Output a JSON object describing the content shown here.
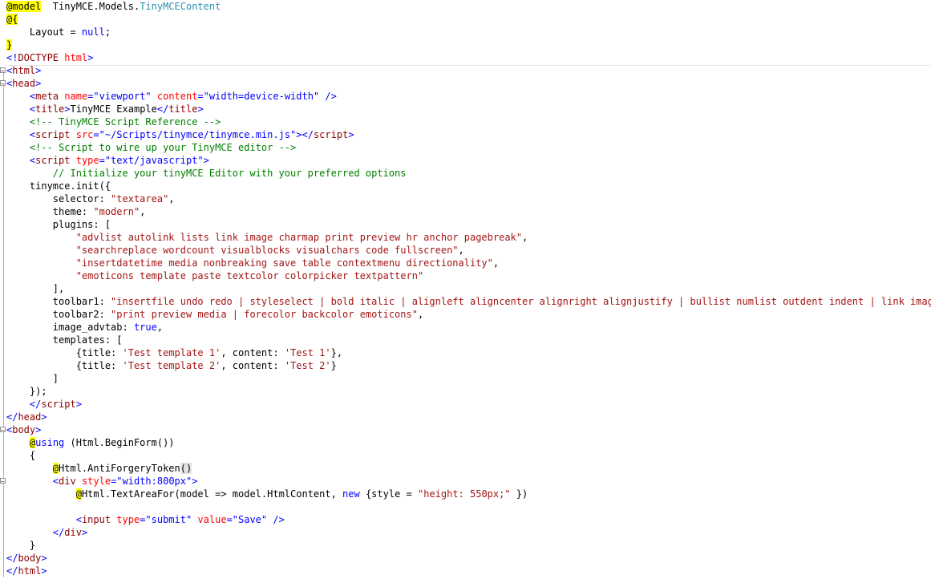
{
  "lines": [
    [
      [
        "hl",
        "@model"
      ],
      [
        "",
        "  TinyMCE.Models."
      ],
      [
        "t",
        "TinyMCEContent"
      ]
    ],
    [
      [
        "hl",
        "@{"
      ]
    ],
    [
      [
        "",
        "    Layout = "
      ],
      [
        "k",
        "null"
      ],
      [
        "",
        ";"
      ]
    ],
    [
      [
        "hl",
        "}"
      ]
    ],
    [
      [
        "k",
        "<!"
      ],
      [
        "m",
        "DOCTYPE"
      ],
      [
        "r",
        " html"
      ],
      [
        "k",
        ">"
      ]
    ],
    [
      [
        "k",
        "<"
      ],
      [
        "m",
        "html"
      ],
      [
        "k",
        ">"
      ]
    ],
    [
      [
        "k",
        "<"
      ],
      [
        "m",
        "head"
      ],
      [
        "k",
        ">"
      ]
    ],
    [
      [
        "",
        "    "
      ],
      [
        "k",
        "<"
      ],
      [
        "m",
        "meta"
      ],
      [
        "r",
        " name"
      ],
      [
        "k",
        "=\"viewport\" "
      ],
      [
        "r",
        "content"
      ],
      [
        "k",
        "=\"width=device-width\" />"
      ]
    ],
    [
      [
        "",
        "    "
      ],
      [
        "k",
        "<"
      ],
      [
        "m",
        "title"
      ],
      [
        "k",
        ">"
      ],
      [
        "",
        "TinyMCE Example"
      ],
      [
        "k",
        "</"
      ],
      [
        "m",
        "title"
      ],
      [
        "k",
        ">"
      ]
    ],
    [
      [
        "",
        "    "
      ],
      [
        "c",
        "<!-- TinyMCE Script Reference -->"
      ]
    ],
    [
      [
        "",
        "    "
      ],
      [
        "k",
        "<"
      ],
      [
        "m",
        "script"
      ],
      [
        "r",
        " src"
      ],
      [
        "k",
        "=\"~/Scripts/tinymce/tinymce.min.js\">"
      ],
      [
        "k",
        "</"
      ],
      [
        "m",
        "script"
      ],
      [
        "k",
        ">"
      ]
    ],
    [
      [
        "",
        "    "
      ],
      [
        "c",
        "<!-- Script to wire up your TinyMCE editor -->"
      ]
    ],
    [
      [
        "",
        "    "
      ],
      [
        "k",
        "<"
      ],
      [
        "m",
        "script"
      ],
      [
        "r",
        " type"
      ],
      [
        "k",
        "=\"text/javascript\">"
      ]
    ],
    [
      [
        "",
        "        "
      ],
      [
        "c",
        "// Initialize your tinyMCE Editor with your preferred options"
      ]
    ],
    [
      [
        "",
        "    tinymce.init({"
      ]
    ],
    [
      [
        "",
        "        selector: "
      ],
      [
        "cs",
        "\"textarea\""
      ],
      [
        "",
        ","
      ]
    ],
    [
      [
        "",
        "        theme: "
      ],
      [
        "cs",
        "\"modern\""
      ],
      [
        "",
        ","
      ]
    ],
    [
      [
        "",
        "        plugins: ["
      ]
    ],
    [
      [
        "",
        "            "
      ],
      [
        "cs",
        "\"advlist autolink lists link image charmap print preview hr anchor pagebreak\""
      ],
      [
        "",
        ","
      ]
    ],
    [
      [
        "",
        "            "
      ],
      [
        "cs",
        "\"searchreplace wordcount visualblocks visualchars code fullscreen\""
      ],
      [
        "",
        ","
      ]
    ],
    [
      [
        "",
        "            "
      ],
      [
        "cs",
        "\"insertdatetime media nonbreaking save table contextmenu directionality\""
      ],
      [
        "",
        ","
      ]
    ],
    [
      [
        "",
        "            "
      ],
      [
        "cs",
        "\"emoticons template paste textcolor colorpicker textpattern\""
      ]
    ],
    [
      [
        "",
        "        ],"
      ]
    ],
    [
      [
        "",
        "        toolbar1: "
      ],
      [
        "cs",
        "\"insertfile undo redo | styleselect | bold italic | alignleft aligncenter alignright alignjustify | bullist numlist outdent indent | link image\""
      ],
      [
        "",
        ","
      ]
    ],
    [
      [
        "",
        "        toolbar2: "
      ],
      [
        "cs",
        "\"print preview media | forecolor backcolor emoticons\""
      ],
      [
        "",
        ","
      ]
    ],
    [
      [
        "",
        "        image_advtab: "
      ],
      [
        "k",
        "true"
      ],
      [
        "",
        ","
      ]
    ],
    [
      [
        "",
        "        templates: ["
      ]
    ],
    [
      [
        "",
        "            {title: "
      ],
      [
        "cs",
        "'Test template 1'"
      ],
      [
        "",
        ", content: "
      ],
      [
        "cs",
        "'Test 1'"
      ],
      [
        "",
        "},"
      ]
    ],
    [
      [
        "",
        "            {title: "
      ],
      [
        "cs",
        "'Test template 2'"
      ],
      [
        "",
        ", content: "
      ],
      [
        "cs",
        "'Test 2'"
      ],
      [
        "",
        "}"
      ]
    ],
    [
      [
        "",
        "        ]"
      ]
    ],
    [
      [
        "",
        "    });"
      ]
    ],
    [
      [
        "",
        "    "
      ],
      [
        "k",
        "</"
      ],
      [
        "m",
        "script"
      ],
      [
        "k",
        ">"
      ]
    ],
    [
      [
        "k",
        "</"
      ],
      [
        "m",
        "head"
      ],
      [
        "k",
        ">"
      ]
    ],
    [
      [
        "k",
        "<"
      ],
      [
        "m",
        "body"
      ],
      [
        "k",
        ">"
      ]
    ],
    [
      [
        "",
        "    "
      ],
      [
        "hl",
        "@"
      ],
      [
        "k",
        "using"
      ],
      [
        "",
        " (Html.BeginForm())"
      ]
    ],
    [
      [
        "",
        "    {"
      ]
    ],
    [
      [
        "",
        "        "
      ],
      [
        "hl",
        "@"
      ],
      [
        "",
        "Html.AntiForgeryToken"
      ],
      [
        "hl2",
        "()"
      ]
    ],
    [
      [
        "",
        "        "
      ],
      [
        "k",
        "<"
      ],
      [
        "m",
        "div"
      ],
      [
        "r",
        " style"
      ],
      [
        "k",
        "=\"width:800px\">"
      ]
    ],
    [
      [
        "",
        "            "
      ],
      [
        "hl",
        "@"
      ],
      [
        "",
        "Html.TextAreaFor(model => model.HtmlContent, "
      ],
      [
        "k",
        "new"
      ],
      [
        "",
        " {style = "
      ],
      [
        "cs",
        "\"height: 550px;\""
      ],
      [
        "",
        " })"
      ]
    ],
    [
      [
        "",
        " "
      ]
    ],
    [
      [
        "",
        "            "
      ],
      [
        "k",
        "<"
      ],
      [
        "m",
        "input"
      ],
      [
        "r",
        " type"
      ],
      [
        "k",
        "=\"submit\" "
      ],
      [
        "r",
        "value"
      ],
      [
        "k",
        "=\"Save\" />"
      ]
    ],
    [
      [
        "",
        "        "
      ],
      [
        "k",
        "</"
      ],
      [
        "m",
        "div"
      ],
      [
        "k",
        ">"
      ]
    ],
    [
      [
        "",
        "    }"
      ]
    ],
    [
      [
        "k",
        "</"
      ],
      [
        "m",
        "body"
      ],
      [
        "k",
        ">"
      ]
    ],
    [
      [
        "k",
        "</"
      ],
      [
        "m",
        "html"
      ],
      [
        "k",
        ">"
      ]
    ]
  ]
}
